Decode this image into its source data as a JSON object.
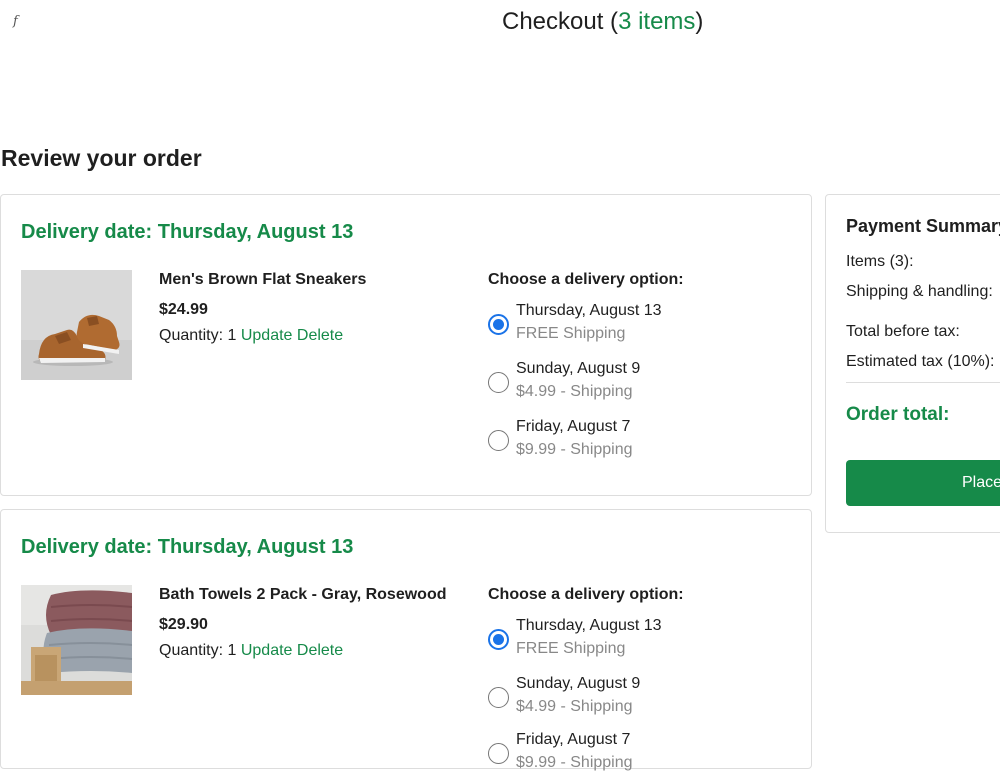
{
  "header": {
    "logo_text": "f",
    "title_prefix": "Checkout (",
    "items_link": "3 items",
    "title_suffix": ")"
  },
  "review_heading": "Review your order",
  "orders": [
    {
      "delivery_date": "Delivery date: Thursday, August 13",
      "product_name": "Men's Brown Flat Sneakers",
      "image": "sneakers-image",
      "price": "$24.99",
      "quantity_label": "Quantity: ",
      "quantity": "1",
      "update_label": "Update",
      "delete_label": "Delete",
      "choose_label": "Choose a delivery option:",
      "options": [
        {
          "date": "Thursday, August 13",
          "price": "FREE Shipping",
          "selected": true
        },
        {
          "date": "Sunday, August 9",
          "price": "$4.99 - Shipping",
          "selected": false
        },
        {
          "date": "Friday, August 7",
          "price": "$9.99 - Shipping",
          "selected": false
        }
      ]
    },
    {
      "delivery_date": "Delivery date: Thursday, August 13",
      "product_name": "Bath Towels 2 Pack - Gray, Rosewood",
      "image": "towels-image",
      "price": "$29.90",
      "quantity_label": "Quantity: ",
      "quantity": "1",
      "update_label": "Update",
      "delete_label": "Delete",
      "choose_label": "Choose a delivery option:",
      "options": [
        {
          "date": "Thursday, August 13",
          "price": "FREE Shipping",
          "selected": true
        },
        {
          "date": "Sunday, August 9",
          "price": "$4.99 - Shipping",
          "selected": false
        },
        {
          "date": "Friday, August 7",
          "price": "$9.99 - Shipping",
          "selected": false
        }
      ]
    }
  ],
  "summary": {
    "title": "Payment Summary",
    "items_label": "Items (3):",
    "shipping_label": "Shipping & handling:",
    "before_tax_label": "Total before tax:",
    "tax_label": "Estimated tax (10%):",
    "order_total_label": "Order total:",
    "place_order_label": "Place your order"
  },
  "colors": {
    "accent_green": "#168a49",
    "radio_blue": "#1a73e8",
    "muted_text": "#888888"
  }
}
